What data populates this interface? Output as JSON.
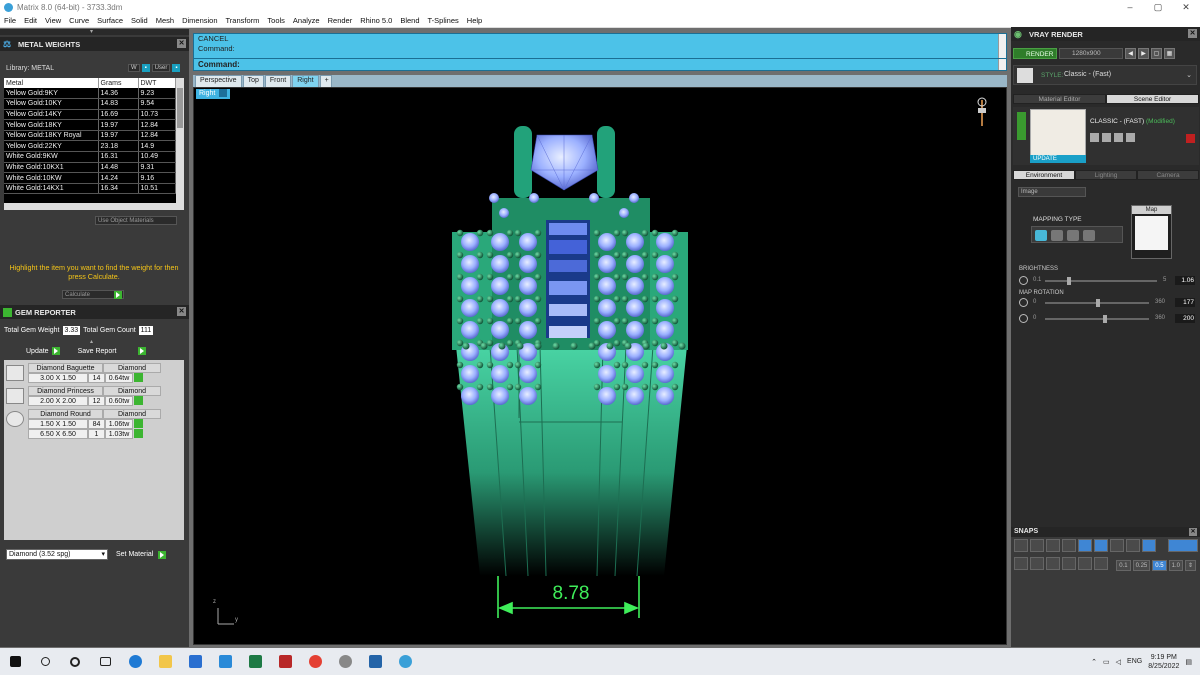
{
  "window": {
    "title": "Matrix 8.0 (64-bit) - 3733.3dm",
    "min": "–",
    "max": "▢",
    "close": "✕"
  },
  "menu": [
    "File",
    "Edit",
    "View",
    "Curve",
    "Surface",
    "Solid",
    "Mesh",
    "Dimension",
    "Transform",
    "Tools",
    "Analyze",
    "Render",
    "Rhino 5.0",
    "Blend",
    "T-Splines",
    "Help"
  ],
  "metal": {
    "title": "METAL WEIGHTS",
    "library": "Library: METAL",
    "unit_buttons": [
      "W",
      "User"
    ],
    "columns": [
      "Metal",
      "Grams",
      "DWT"
    ],
    "rows": [
      [
        "Yellow Gold:9KY",
        "14.36",
        "9.23"
      ],
      [
        "Yellow Gold:10KY",
        "14.83",
        "9.54"
      ],
      [
        "Yellow Gold:14KY",
        "16.69",
        "10.73"
      ],
      [
        "Yellow Gold:18KY",
        "19.97",
        "12.84"
      ],
      [
        "Yellow Gold:18KY Royal",
        "19.97",
        "12.84"
      ],
      [
        "Yellow Gold:22KY",
        "23.18",
        "14.9"
      ],
      [
        "White Gold:9KW",
        "16.31",
        "10.49"
      ],
      [
        "White Gold:10KX1",
        "14.48",
        "9.31"
      ],
      [
        "White Gold:10KW",
        "14.24",
        "9.16"
      ],
      [
        "White Gold:14KX1",
        "16.34",
        "10.51"
      ]
    ],
    "use_object": "Use Object Materials",
    "hint": "Highlight the item you want to find the weight for then press Calculate.",
    "calculate": "Calculate"
  },
  "gem": {
    "title": "GEM REPORTER",
    "total_weight_label": "Total Gem Weight",
    "total_weight": "3.33",
    "total_count_label": "Total Gem Count",
    "total_count": "111",
    "update": "Update",
    "save_report": "Save Report",
    "groups": [
      {
        "name": "Diamond Baguette",
        "material": "Diamond",
        "rows": [
          [
            "3.00 X 1.50",
            "14",
            "0.64tw"
          ]
        ]
      },
      {
        "name": "Diamond Princess",
        "material": "Diamond",
        "rows": [
          [
            "2.00 X 2.00",
            "12",
            "0.60tw"
          ]
        ]
      },
      {
        "name": "Diamond Round",
        "material": "Diamond",
        "rows": [
          [
            "1.50 X 1.50",
            "84",
            "1.06tw"
          ],
          [
            "6.50 X 6.50",
            "1",
            "1.03tw"
          ]
        ]
      }
    ],
    "material_select": "Diamond    (3.52 spg)",
    "set_material": "Set Material"
  },
  "command": {
    "line1": "CANCEL",
    "line2": "Command:",
    "prompt": "Command:"
  },
  "view_tabs": [
    "Perspective",
    "Top",
    "Front",
    "Right"
  ],
  "active_tab": "Right",
  "viewport": {
    "label": "Right",
    "dimension": "8.78",
    "axis_z": "z",
    "axis_y": "y"
  },
  "vray": {
    "title": "VRAY RENDER",
    "render": "RENDER",
    "resolution": "1280x900",
    "style_label": "STYLE:",
    "style_value": "Classic - (Fast)",
    "editor_tabs": [
      "Material Editor",
      "Scene Editor"
    ],
    "material_name": "CLASSIC - (FAST)",
    "modified": "(Modified)",
    "update": "UPDATE",
    "env_tabs": [
      "Environment",
      "Lighting",
      "Camera"
    ],
    "image_select": "Image",
    "mapping_type": "MAPPING TYPE",
    "map_label": "Map",
    "brightness_label": "BRIGHTNESS",
    "brightness": {
      "min": "0.1",
      "max": "5",
      "value": "1.06",
      "fraction": 0.2
    },
    "map_rotation_label": "MAP ROTATION",
    "rotation1": {
      "min": "0",
      "max": "360",
      "value": "177",
      "fraction": 0.49
    },
    "rotation2": {
      "min": "0",
      "max": "360",
      "value": "200",
      "fraction": 0.56
    }
  },
  "snaps": {
    "title": "SNAPS",
    "values": [
      "0.1",
      "0.25",
      "0.5",
      "1.0"
    ]
  },
  "taskbar": {
    "lang": "ENG",
    "time": "9:19 PM",
    "date": "8/25/2022"
  }
}
